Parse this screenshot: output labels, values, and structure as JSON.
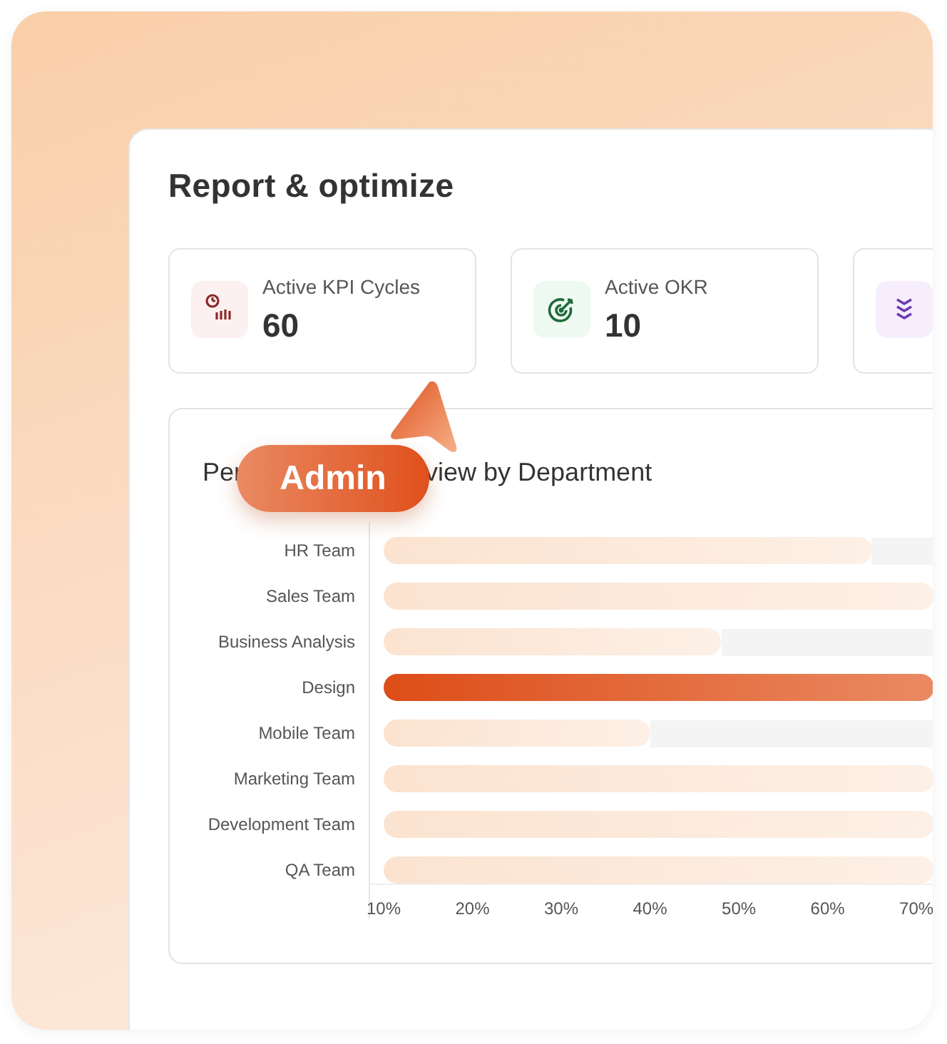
{
  "page": {
    "title": "Report & optimize"
  },
  "stats": [
    {
      "kind": "chart",
      "label": "Active KPI Cycles",
      "value": "60"
    },
    {
      "kind": "target",
      "label": "Active OKR",
      "value": "10"
    },
    {
      "kind": "chevrons"
    }
  ],
  "performance": {
    "title_start": "Per",
    "title_end": "view by Department",
    "bars": [
      {
        "selected": false
      },
      {
        "selected": false
      },
      {
        "selected": false
      },
      {
        "selected": true
      },
      {
        "selected": false
      },
      {
        "selected": false
      },
      {
        "selected": false
      },
      {
        "selected": false
      }
    ],
    "chart_data": {
      "type": "bar",
      "orientation": "horizontal",
      "categories": [
        "HR Team",
        "Sales Team",
        "Business Analysis",
        "Design",
        "Mobile Team",
        "Marketing Team",
        "Development Team",
        "QA Team"
      ],
      "values": [
        65,
        72,
        48,
        72,
        40,
        72,
        72,
        72
      ],
      "xlim": [
        10,
        72
      ],
      "xticks": [
        {
          "value": 10,
          "label": "10%"
        },
        {
          "value": 20,
          "label": "20%"
        },
        {
          "value": 30,
          "label": "30%"
        },
        {
          "value": 40,
          "label": "40%"
        },
        {
          "value": 50,
          "label": "50%"
        },
        {
          "value": 60,
          "label": "60%"
        },
        {
          "value": 70,
          "label": "70%"
        }
      ]
    }
  },
  "badge": {
    "label": "Admin"
  }
}
